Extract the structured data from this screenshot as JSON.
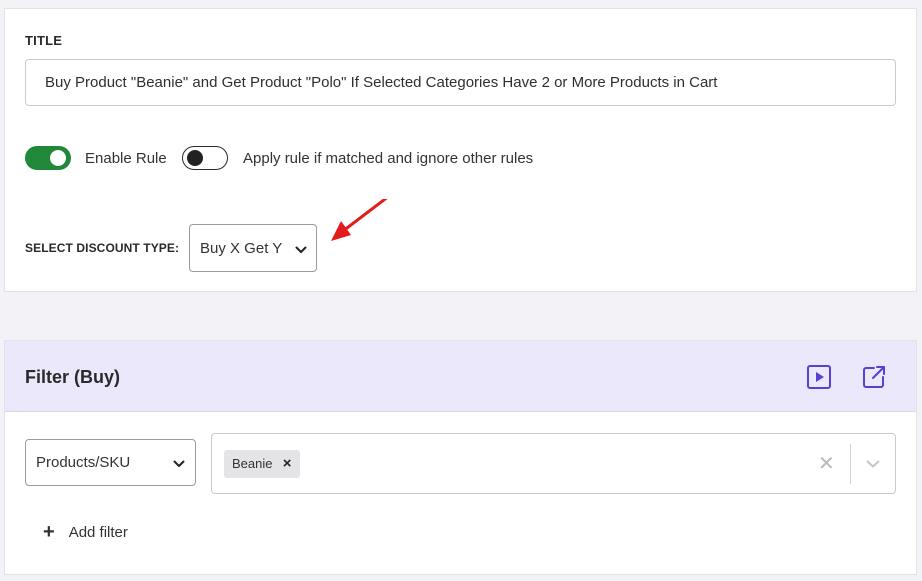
{
  "rule": {
    "title_label": "TITLE",
    "title_value": "Buy Product \"Beanie\" and Get Product \"Polo\" If Selected Categories Have 2 or More Products in Cart",
    "enable_rule_label": "Enable Rule",
    "enable_rule_on": true,
    "apply_rule_label": "Apply rule if matched and ignore other rules",
    "apply_rule_on": false,
    "discount_type_label": "SELECT DISCOUNT TYPE:",
    "discount_type_value": "Buy X Get Y"
  },
  "filter": {
    "title": "Filter (Buy)",
    "type_value": "Products/SKU",
    "selected_items": [
      "Beanie"
    ],
    "add_filter_label": "Add filter"
  },
  "icons": {
    "video": "play-square-icon",
    "open": "external-link-icon",
    "annotation": "red-arrow-icon"
  },
  "colors": {
    "toggle_on": "#21883a",
    "filter_header": "#ece8fc",
    "filter_icon": "#5b3fd1",
    "annotation_arrow": "#e31b1b"
  }
}
